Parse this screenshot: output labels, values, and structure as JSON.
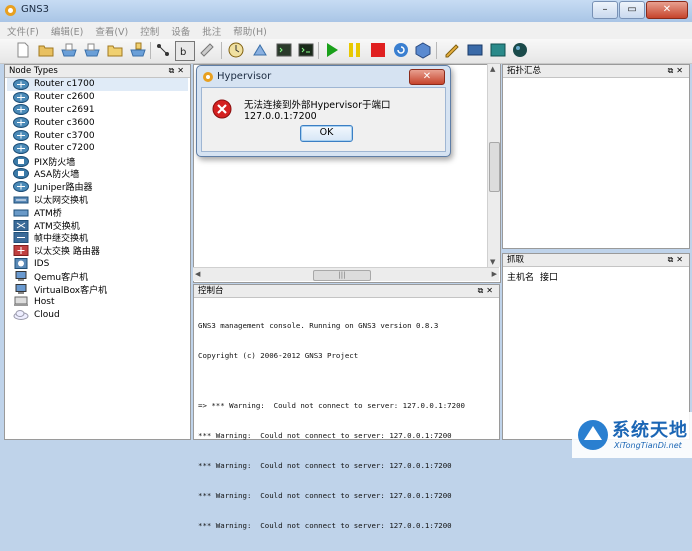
{
  "window": {
    "title": "GNS3"
  },
  "menu": [
    "文件(F)",
    "编辑(E)",
    "查看(V)",
    "控制",
    "设备",
    "批注",
    "帮助(H)"
  ],
  "node_types": {
    "title": "Node Types",
    "items": [
      {
        "label": "Router c1700",
        "icon": "router-icon"
      },
      {
        "label": "Router c2600",
        "icon": "router-icon"
      },
      {
        "label": "Router c2691",
        "icon": "router-icon"
      },
      {
        "label": "Router c3600",
        "icon": "router-icon"
      },
      {
        "label": "Router c3700",
        "icon": "router-icon"
      },
      {
        "label": "Router c7200",
        "icon": "router-icon"
      },
      {
        "label": "PIX防火墙",
        "icon": "firewall-icon"
      },
      {
        "label": "ASA防火墙",
        "icon": "firewall-icon"
      },
      {
        "label": "Juniper路由器",
        "icon": "router-icon"
      },
      {
        "label": "以太网交换机",
        "icon": "switch-icon"
      },
      {
        "label": "ATM桥",
        "icon": "bridge-icon"
      },
      {
        "label": "ATM交换机",
        "icon": "atm-switch-icon"
      },
      {
        "label": "帧中继交换机",
        "icon": "frame-relay-icon"
      },
      {
        "label": "以太交换 路由器",
        "icon": "ethernet-switch-router-icon"
      },
      {
        "label": "IDS",
        "icon": "ids-icon"
      },
      {
        "label": "Qemu客户机",
        "icon": "computer-icon"
      },
      {
        "label": "VirtualBox客户机",
        "icon": "computer-icon"
      },
      {
        "label": "Host",
        "icon": "host-icon"
      },
      {
        "label": "Cloud",
        "icon": "cloud-icon"
      }
    ]
  },
  "topology_summary": {
    "title": "拓扑汇总"
  },
  "capture": {
    "title": "抓取",
    "col_host": "主机名",
    "col_interface": "接口"
  },
  "console": {
    "title": "控制台",
    "lines": [
      "GNS3 management console. Running on GNS3 version 0.8.3",
      "Copyright (c) 2006-2012 GNS3 Project",
      "",
      "=> *** Warning:  Could not connect to server: 127.0.0.1:7200",
      "*** Warning:  Could not connect to server: 127.0.0.1:7200",
      "*** Warning:  Could not connect to server: 127.0.0.1:7200",
      "*** Warning:  Could not connect to server: 127.0.0.1:7200",
      "*** Warning:  Could not connect to server: 127.0.0.1:7200"
    ]
  },
  "dialog": {
    "title": "Hypervisor",
    "message": "无法连接到外部Hypervisor于端口127.0.0.1:7200",
    "ok_label": "OK"
  },
  "watermark": {
    "text": "系统天地",
    "url": "XiTongTianDi.net"
  },
  "colors": {
    "play": "#1aa01a",
    "pause": "#e8c800",
    "stop": "#e02020",
    "error": "#d42020"
  }
}
